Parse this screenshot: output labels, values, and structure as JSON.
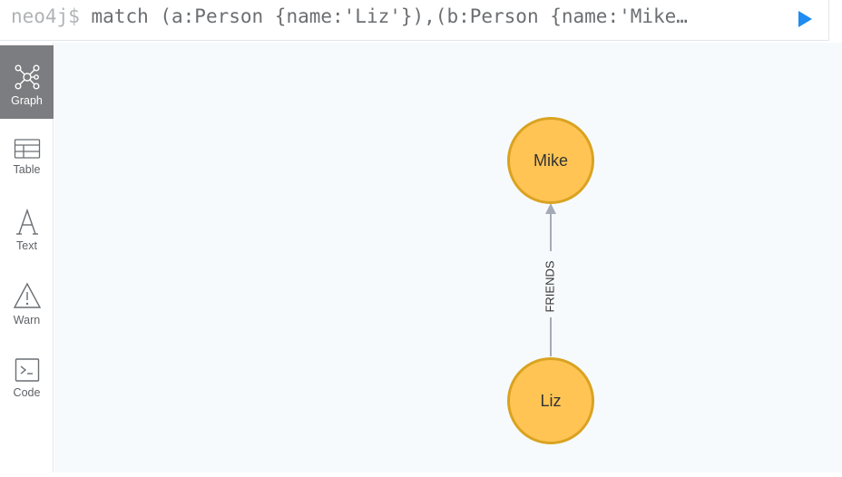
{
  "query": {
    "prompt": "neo4j$",
    "text": "match (a:Person {name:'Liz'}),(b:Person {name:'Mike…",
    "run_icon": "play-icon",
    "run_color": "#1e8cf0"
  },
  "sidebar": {
    "items": [
      {
        "label": "Graph",
        "icon": "graph-icon",
        "active": true
      },
      {
        "label": "Table",
        "icon": "table-icon",
        "active": false
      },
      {
        "label": "Text",
        "icon": "text-icon",
        "active": false
      },
      {
        "label": "Warn",
        "icon": "warning-icon",
        "active": false
      },
      {
        "label": "Code",
        "icon": "code-icon",
        "active": false
      }
    ]
  },
  "graph": {
    "nodes": [
      {
        "label": "Mike",
        "type": "Person"
      },
      {
        "label": "Liz",
        "type": "Person"
      }
    ],
    "relationships": [
      {
        "type": "FRIENDS",
        "from": "Liz",
        "to": "Mike"
      }
    ],
    "node_color": "#ffc454",
    "node_border": "#d9a321"
  }
}
